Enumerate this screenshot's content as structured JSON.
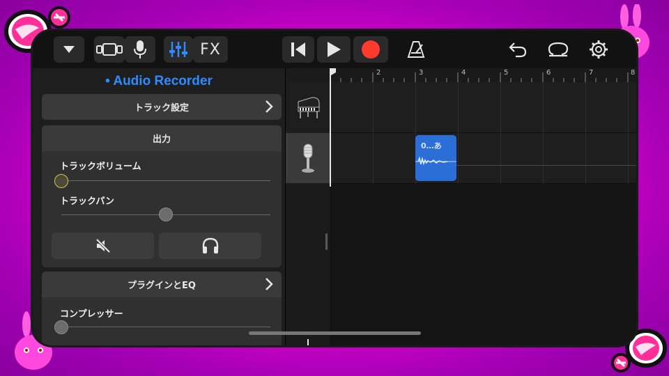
{
  "toolbar": {
    "fx_label": "FX",
    "icons": [
      "menu-dropdown-icon",
      "tracks-view-icon",
      "microphone-icon",
      "mixer-icon",
      "rewind-icon",
      "play-icon",
      "record-icon",
      "metronome-icon",
      "undo-icon",
      "loop-icon",
      "settings-icon"
    ]
  },
  "panel": {
    "title": "• Audio Recorder",
    "track_settings_label": "トラック設定",
    "output": {
      "header": "出力",
      "volume_label": "トラックボリューム",
      "volume_level": 0,
      "pan_label": "トラックパン",
      "pan_level": 0.5
    },
    "plugins_label": "プラグインとEQ",
    "compressor_label": "コンプレッサー",
    "compressor_level": 0
  },
  "ruler": {
    "bars": [
      "2",
      "3",
      "4",
      "5",
      "6",
      "7",
      "8"
    ]
  },
  "region": {
    "label": "0…あ"
  },
  "tracks": [
    {
      "name": "grand-piano",
      "icon": "piano-icon"
    },
    {
      "name": "audio-recorder",
      "icon": "microphone-icon"
    }
  ],
  "colors": {
    "accent": "#2f8cff",
    "record": "#ff3b30",
    "region": "#2b6fd6",
    "background": "#e000d0"
  }
}
